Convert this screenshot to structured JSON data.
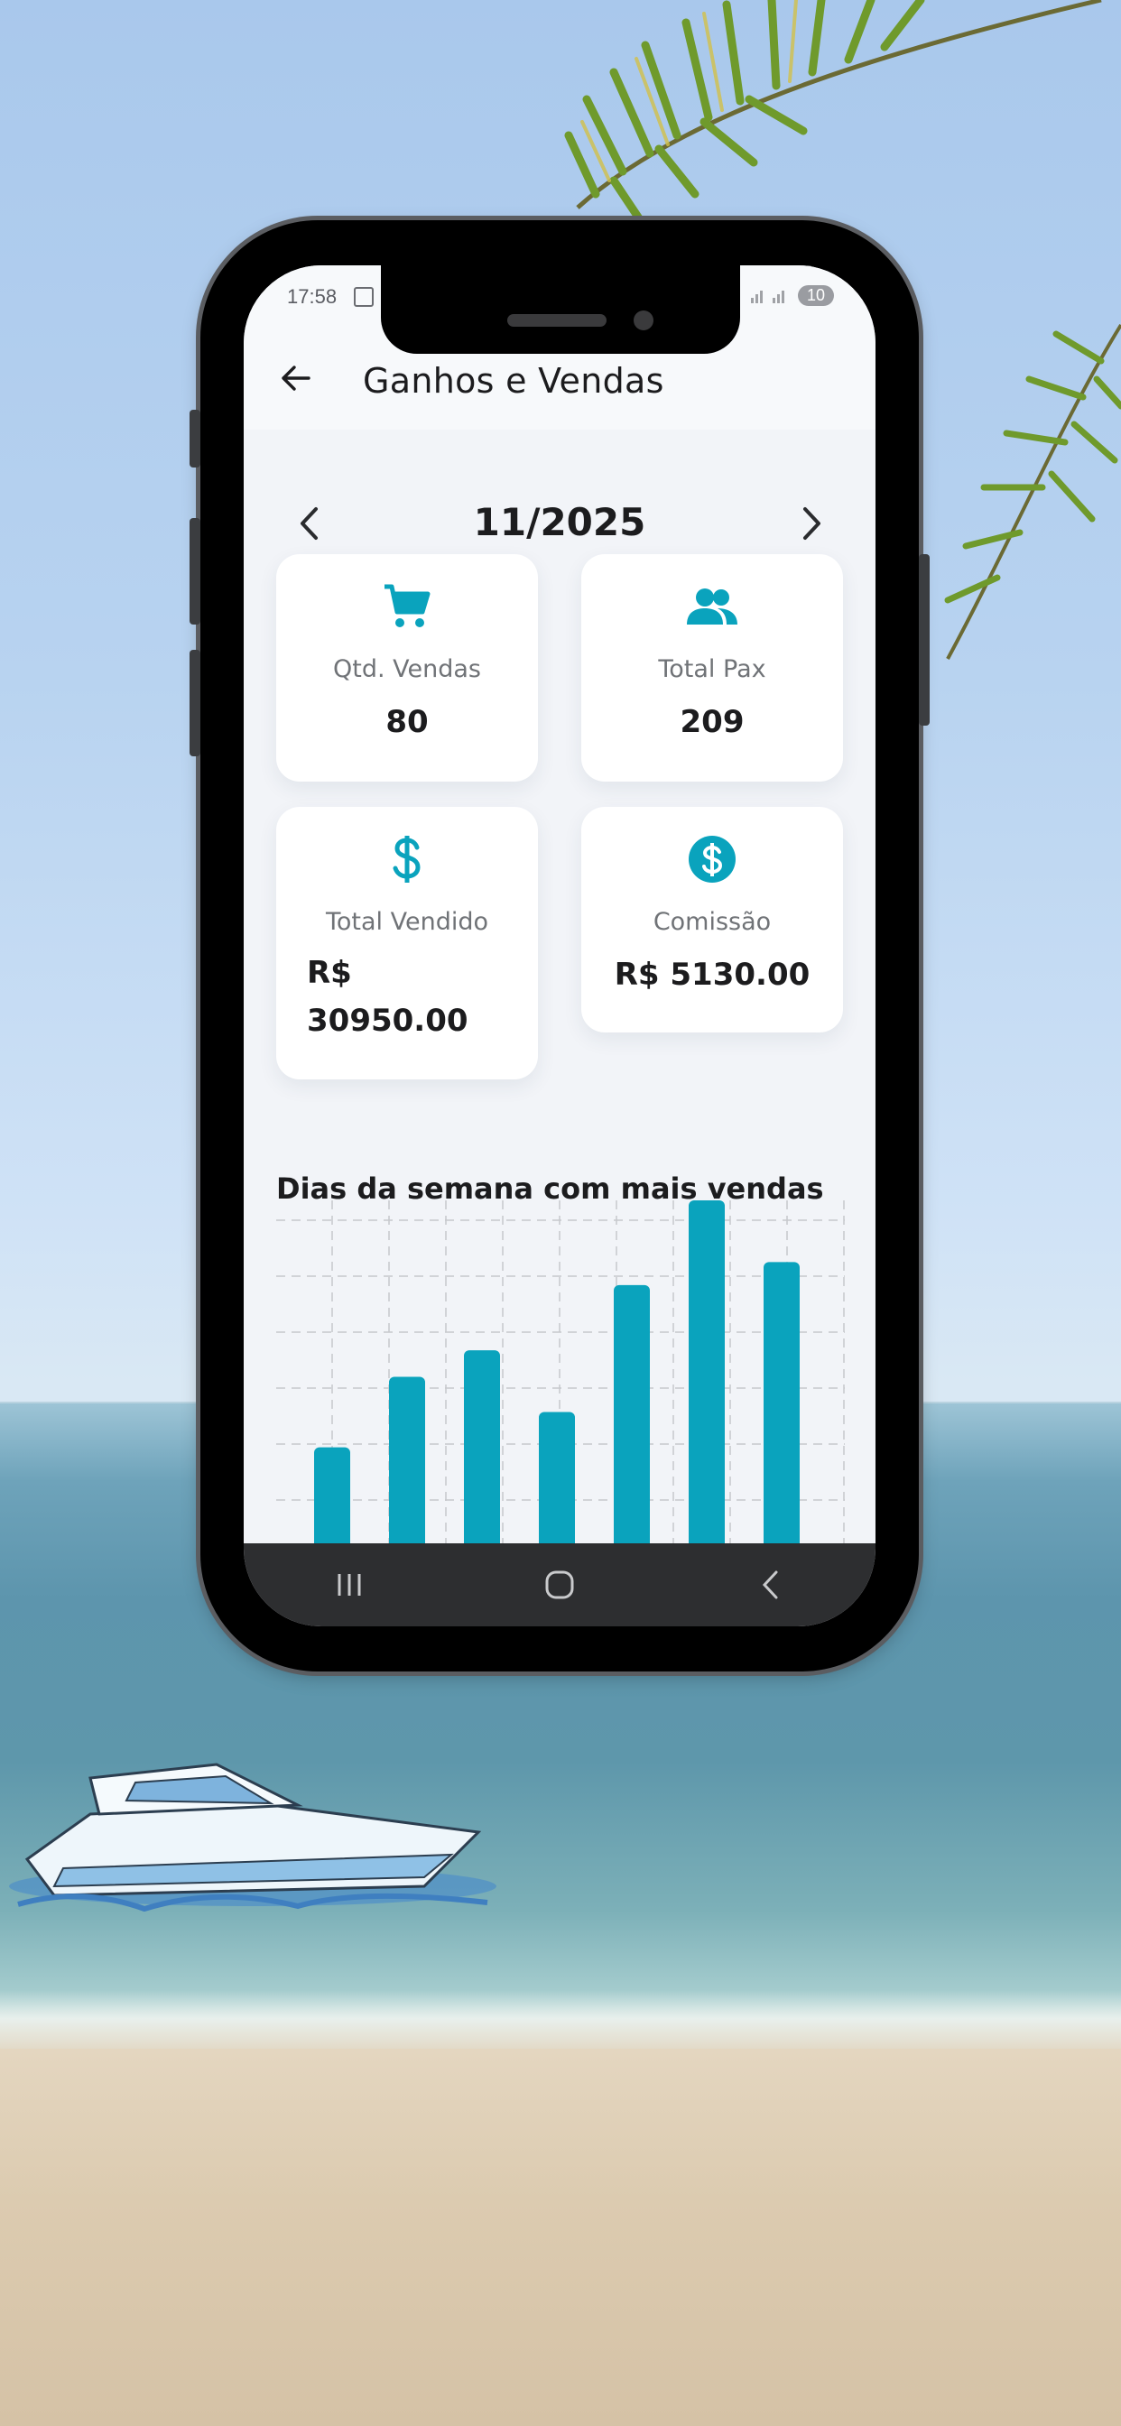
{
  "status_bar": {
    "time": "17:58",
    "battery": "10"
  },
  "app_bar": {
    "title": "Ganhos e Vendas",
    "back_icon": "arrow-left-icon"
  },
  "month_selector": {
    "label": "11/2025",
    "prev_icon": "chevron-left-icon",
    "next_icon": "chevron-right-icon"
  },
  "cards": [
    {
      "label": "Qtd. Vendas",
      "value": "80",
      "icon": "cart-icon"
    },
    {
      "label": "Total Pax",
      "value": "209",
      "icon": "people-icon"
    },
    {
      "label": "Total Vendido",
      "value": "R$ 30950.00",
      "icon": "dollar-icon"
    },
    {
      "label": "Comissão",
      "value": "R$ 5130.00",
      "icon": "dollar-circle-icon"
    }
  ],
  "colors": {
    "accent": "#0aa3bd",
    "background": "#f2f4f8",
    "card": "#ffffff",
    "text": "#1c1c1e",
    "muted": "#707377",
    "navbar": "#2d2e30"
  },
  "chart_title": "Dias da semana com mais vendas",
  "chart_data": {
    "type": "bar",
    "title": "Dias da semana com mais vendas",
    "values": [
      8,
      12,
      13.5,
      10,
      17.2,
      22,
      18.5
    ],
    "ylim": [
      0,
      22
    ],
    "grid": true
  },
  "navbar": {
    "recents_icon": "recents-icon",
    "home_icon": "home-icon",
    "back_icon": "back-chevron-icon"
  }
}
